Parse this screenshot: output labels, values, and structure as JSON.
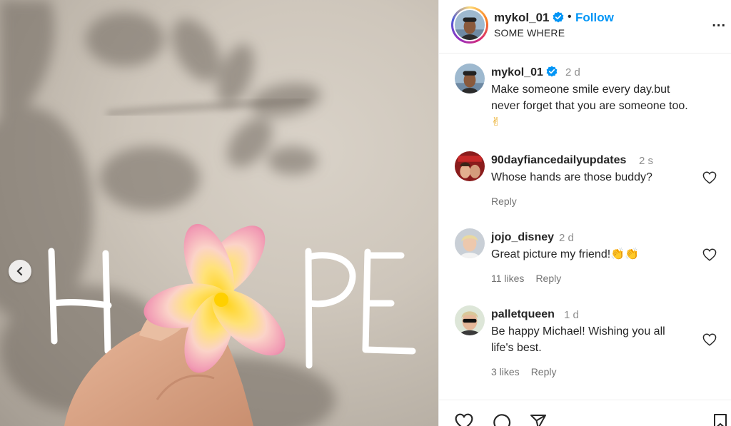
{
  "media": {
    "text_left": "H",
    "text_right": "PE"
  },
  "post": {
    "username": "mykol_01",
    "separator": "•",
    "follow_label": "Follow",
    "location": "SOME WHERE",
    "more_label": "..."
  },
  "caption": {
    "username": "mykol_01",
    "time": "2 d",
    "text_line1": "Make someone smile every day.but",
    "text_line2": "never forget that you are someone too.",
    "emoji": "✌"
  },
  "comments": [
    {
      "username": "90dayfiancedailyupdates",
      "time": "2 s",
      "text": "Whose hands are those buddy?",
      "likes": "",
      "reply": "Reply"
    },
    {
      "username": "jojo_disney",
      "time": "2 d",
      "text": "Great picture my friend!",
      "emoji": "👏👏",
      "likes": "11 likes",
      "reply": "Reply"
    },
    {
      "username": "palletqueen",
      "time": "1 d",
      "text_line1": "Be happy Michael! Wishing you all",
      "text_line2": "life's best.",
      "likes": "3 likes",
      "reply": "Reply"
    }
  ],
  "colors": {
    "accent": "#0095f6",
    "verified": "#0095f6",
    "muted": "#8e8e8e"
  }
}
